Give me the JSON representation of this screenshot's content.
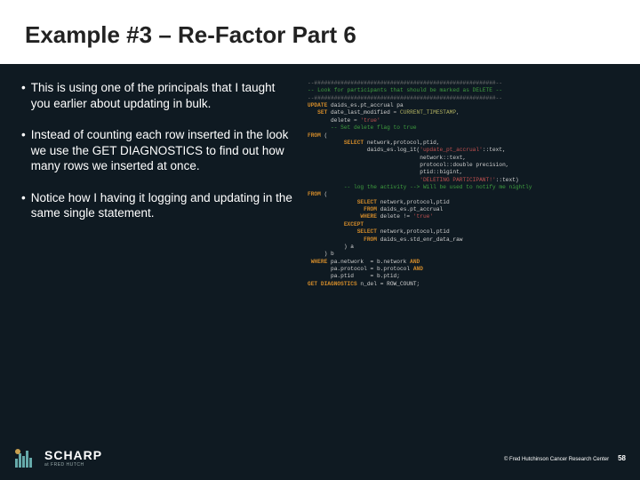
{
  "title": "Example #3 – Re-Factor Part 6",
  "bullets": [
    "This is using one of the principals that I taught you earlier about updating in bulk.",
    "Instead of counting each row inserted in the look we use the GET DIAGNOSTICS to find out how many rows we inserted at once.",
    "Notice how I having it logging and updating in the same single statement."
  ],
  "code": {
    "l1": "--#######################################################--",
    "l2": "-- Look for participants that should be marked as DELETE --",
    "l3": "--#######################################################--",
    "l4a": "UPDATE",
    "l4b": " daids_es.pt_accrual pa",
    "l5a": "   SET",
    "l5b": " date_last_modified ",
    "l5c": "=",
    "l5d": " CURRENT_TIMESTAMP",
    "l5e": ",",
    "l6a": "       delete ",
    "l6b": "=",
    "l6c": " 'true'",
    "l7": "       -- Set delete flag to true",
    "l8a": "FROM",
    "l8b": " (",
    "l9a": "           SELECT",
    "l9b": " network,protocol,ptid,",
    "l10a": "                  daids_es.log_it(",
    "l10b": "'update_pt_accrual'",
    "l10c": "::text,",
    "l11a": "                                  network::text,",
    "l12a": "                                  protocol::double precision,",
    "l13a": "                                  ptid::bigint,",
    "l14a": "                                  ",
    "l14b": "'DELETING PARTICIPANT!'",
    "l14c": "::text)",
    "l15": "           -- log the activity --> Will be used to notify me nightly",
    "l16a": "FROM",
    "l16b": " (",
    "l17a": "               SELECT",
    "l17b": " network,protocol,ptid",
    "l18a": "                 FROM",
    "l18b": " daids_es.pt_accrual",
    "l19a": "                WHERE",
    "l19b": " delete != ",
    "l19c": "'true'",
    "l20": "           EXCEPT",
    "l21a": "               SELECT",
    "l21b": " network,protocol,ptid",
    "l22a": "                 FROM",
    "l22b": " daids_es.std_enr_data_raw",
    "l23": "           ) a",
    "l24": "     ) b",
    "l25a": " WHERE",
    "l25b": " pa.network  = b.network ",
    "l25c": "AND",
    "l26a": "       pa.protocol = b.protocol ",
    "l26b": "AND",
    "l27": "       pa.ptid     = b.ptid;",
    "l28a": "GET DIAGNOSTICS",
    "l28b": " n_del = ROW_COUNT;"
  },
  "logo": {
    "name": "SCHARP",
    "sub": "at FRED HUTCH"
  },
  "footer": {
    "copyright": "© Fred Hutchinson Cancer Research Center",
    "page": "58"
  }
}
